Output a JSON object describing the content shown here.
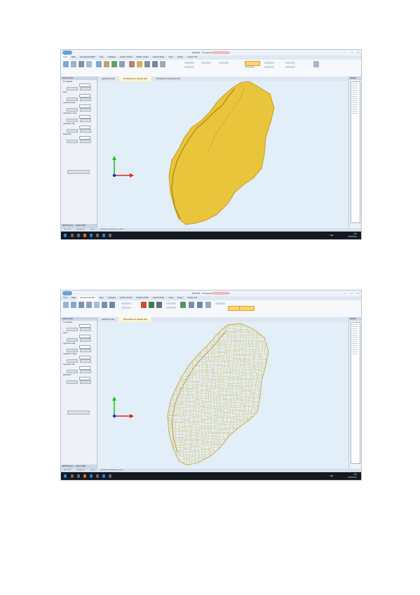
{
  "colors": {
    "solid_fill": "#e9c53b",
    "solid_stroke": "#c89c20",
    "wire": "#d8bf63",
    "axis_x": "#e02020",
    "axis_y": "#19c619",
    "axis_origin": "#1b2fd6",
    "accent": "#6aa1d8"
  },
  "screenshots": [
    {
      "window_title": "MDTop5 - Triangulación de pahs2D (2/2)",
      "tabs": [
        "Inicio",
        "Edita",
        "Herramientas MDT",
        "Vista",
        "Utilidades",
        "Archivo CASIO",
        "Modelo CASIO",
        "Gestión Multip",
        "Vuelo",
        "Dragon",
        "Gestión TIN"
      ],
      "active_tab": "Inicio",
      "doc_tabs": [
        "pahs2D (2).dwg",
        "Triangulación de pahs2D (2/2)",
        "Triangulación de pahs2D (2/2)"
      ],
      "panel_title": "Nodo CASIO",
      "groups": [
        "Sin clasificar",
        "Suelo",
        "Vegetación baja",
        "Vegetación media",
        "Vegetación alta",
        "Edificación"
      ],
      "field_label": "Distancia",
      "buttons": [
        "Asignar",
        "Ver más"
      ],
      "apply_button": "Crear sección",
      "left_tabs": [
        "MDT/Proyecto",
        "Nodo CASIO"
      ],
      "right_panel_title": "Nodo/M",
      "status": [
        "Cota: 0.00",
        "Cambio: 0.0",
        "0.5 ms",
        "Seleccione entidades para contar"
      ],
      "tray_time": "9:59",
      "tray_date": "22/06/2021",
      "render_mode": "solid"
    },
    {
      "window_title": "MDTop5 - Triangulación de pahs2D (2/2)",
      "tabs": [
        "Inicio",
        "Edita",
        "Herramientas MDT",
        "Vista",
        "Utilidades",
        "Archivo CASIO",
        "Modelo CASIO",
        "Gestión Multip",
        "Vuelo",
        "Dragon",
        "Gestión TIN"
      ],
      "active_tab": "Herramientas MDT",
      "doc_tabs": [
        "pahs2D (2).dwg",
        "Triangulación de pahs2D (2/2)"
      ],
      "panel_title": "Nodo CASIO",
      "groups": [
        "Sin clasificar",
        "Suelo",
        "Vegetación baja",
        "Vegetación media",
        "Vegetación alta",
        "Edificación"
      ],
      "field_label": "Distancia",
      "buttons": [
        "Asignar",
        "Ver más"
      ],
      "apply_button": "Crear sección",
      "left_tabs": [
        "MDT/Proyecto",
        "Nodo CASIO"
      ],
      "right_panel_title": "Nodo/M",
      "status": [
        "Cota: 0.00",
        "Cambio: 0.0",
        "0.5 ms",
        "Seleccione entidades para contar"
      ],
      "tray_time": "9:59",
      "tray_date": "22/06/2021",
      "render_mode": "wireframe"
    }
  ]
}
